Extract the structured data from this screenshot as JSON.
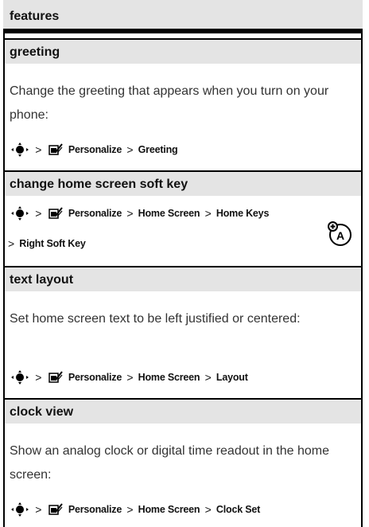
{
  "header": {
    "title": "features"
  },
  "sections": {
    "greeting": {
      "title": "greeting",
      "body": "Change the greeting that appears when you turn on your phone:",
      "path": {
        "p1": "Personalize",
        "p2": "Greeting"
      }
    },
    "soft_key": {
      "title": "change home screen soft key",
      "path": {
        "p1": "Personalize",
        "p2": "Home Screen",
        "p3": "Home Keys",
        "p4": "Right Soft Key"
      }
    },
    "text_layout": {
      "title": "text layout",
      "body": "Set home screen text to be left justified or centered:",
      "path": {
        "p1": "Personalize",
        "p2": "Home Screen",
        "p3": "Layout"
      }
    },
    "clock_view": {
      "title": "clock view",
      "body": "Show an analog clock or digital time readout in the home screen:",
      "path": {
        "p1": "Personalize",
        "p2": "Home Screen",
        "p3": "Clock Set"
      }
    }
  },
  "icons": {
    "nav_key": "nav-key-icon",
    "personalize": "personalize-icon",
    "operator_feature": "operator-feature-icon"
  },
  "colors": {
    "title_bar": "#e4e4e4",
    "rule": "#000000"
  }
}
